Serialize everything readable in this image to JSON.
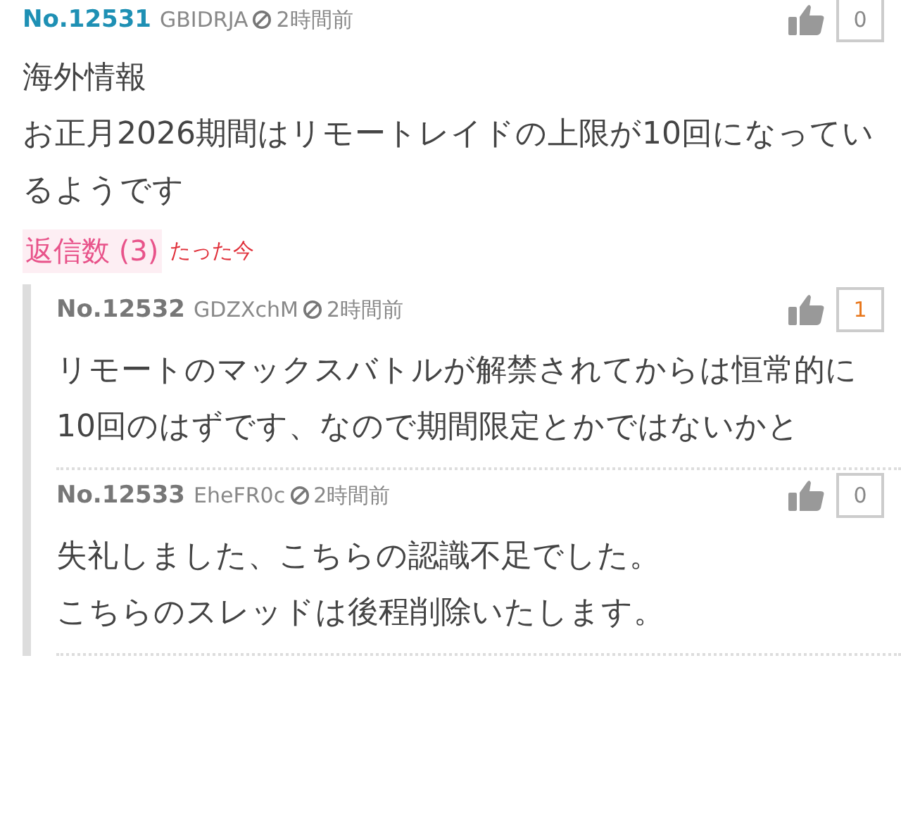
{
  "post": {
    "number": "No.12531",
    "user_id": "GBIDRJA",
    "time": "2時間前",
    "votes": "0",
    "votes_highlighted": false,
    "body": [
      "海外情報",
      "お正月2026期間はリモートレイドの上限が10回になっているようです"
    ],
    "reply_count": "返信数 (3)",
    "last_reply": "たった今",
    "replies": [
      {
        "number": "No.12532",
        "user_id": "GDZXchM",
        "time": "2時間前",
        "votes": "1",
        "votes_highlighted": true,
        "body": [
          "リモートのマックスバトルが解禁されてからは恒常的に10回のはずです、なので期間限定とかではないかと"
        ]
      },
      {
        "number": "No.12533",
        "user_id": "EheFR0c",
        "time": "2時間前",
        "votes": "0",
        "votes_highlighted": false,
        "body": [
          "失礼しました、こちらの認識不足でした。",
          "こちらのスレッドは後程削除いたします。"
        ]
      }
    ]
  }
}
